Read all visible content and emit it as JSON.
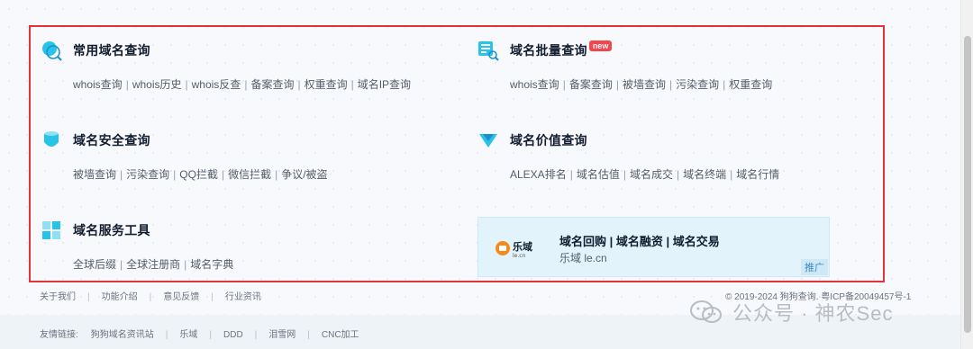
{
  "cards": {
    "common": {
      "title": "常用域名查询",
      "links": [
        "whois查询",
        "whois历史",
        "whois反查",
        "备案查询",
        "权重查询",
        "域名IP查询"
      ]
    },
    "batch": {
      "title": "域名批量查询",
      "badge": "new",
      "links": [
        "whois查询",
        "备案查询",
        "被墙查询",
        "污染查询",
        "权重查询"
      ]
    },
    "security": {
      "title": "域名安全查询",
      "links": [
        "被墙查询",
        "污染查询",
        "QQ拦截",
        "微信拦截",
        "争议/被盗"
      ]
    },
    "value": {
      "title": "域名价值查询",
      "links": [
        "ALEXA排名",
        "域名估值",
        "域名成交",
        "域名终端",
        "域名行情"
      ]
    },
    "tools": {
      "title": "域名服务工具",
      "links": [
        "全球后缀",
        "全球注册商",
        "域名字典"
      ]
    }
  },
  "promo": {
    "logo_text": "乐域",
    "logo_sub": "le.cn",
    "main": "域名回购 | 域名融资 | 域名交易",
    "sub": "乐域 le.cn",
    "tag": "推广"
  },
  "footer": {
    "nav": [
      "关于我们",
      "功能介绍",
      "意见反馈",
      "行业资讯"
    ],
    "copyright": "© 2019-2024 狗狗查询. 粤ICP备20049457号-1",
    "friend_label": "友情链接:",
    "friend_links": [
      "狗狗域名资讯站",
      "乐域",
      "DDD",
      "泪雪网",
      "CNC加工"
    ]
  },
  "watermark": {
    "text": "公众号 · 神农Sec"
  },
  "colors": {
    "highlight": "#e0333a",
    "accent_cyan": "#27c3e8",
    "badge_red": "#f2454c"
  }
}
